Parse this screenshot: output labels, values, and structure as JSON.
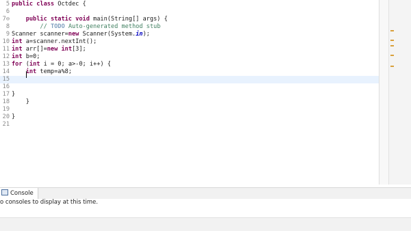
{
  "editor": {
    "lines": [
      {
        "num": "5",
        "text": "public class Octdec {"
      },
      {
        "num": "6",
        "text": ""
      },
      {
        "num": "7⊖",
        "text": "    public static void main(String[] args) {"
      },
      {
        "num": "8",
        "text": "        // TODO Auto-generated method stub"
      },
      {
        "num": "9",
        "text": "Scanner scanner=new Scanner(System.in);"
      },
      {
        "num": "10",
        "text": "int a=scanner.nextInt();"
      },
      {
        "num": "11",
        "text": "int arr[]=new int[3];"
      },
      {
        "num": "12",
        "text": "int b=0;"
      },
      {
        "num": "13",
        "text": "for (int i = 0; a>-0; i++) {"
      },
      {
        "num": "14",
        "text": "    int temp=a%8;"
      },
      {
        "num": "15",
        "text": "    "
      },
      {
        "num": "16",
        "text": ""
      },
      {
        "num": "17",
        "text": "}"
      },
      {
        "num": "18",
        "text": "    }"
      },
      {
        "num": "19",
        "text": ""
      },
      {
        "num": "20",
        "text": "}"
      },
      {
        "num": "21",
        "text": ""
      }
    ],
    "current_line": 15
  },
  "console": {
    "tab_label": "Console",
    "message": "o consoles to display at this time."
  },
  "colors": {
    "keyword": "#7f0055",
    "comment": "#3f7f5f",
    "field": "#0000c0",
    "current_line": "#e8f2fe"
  }
}
